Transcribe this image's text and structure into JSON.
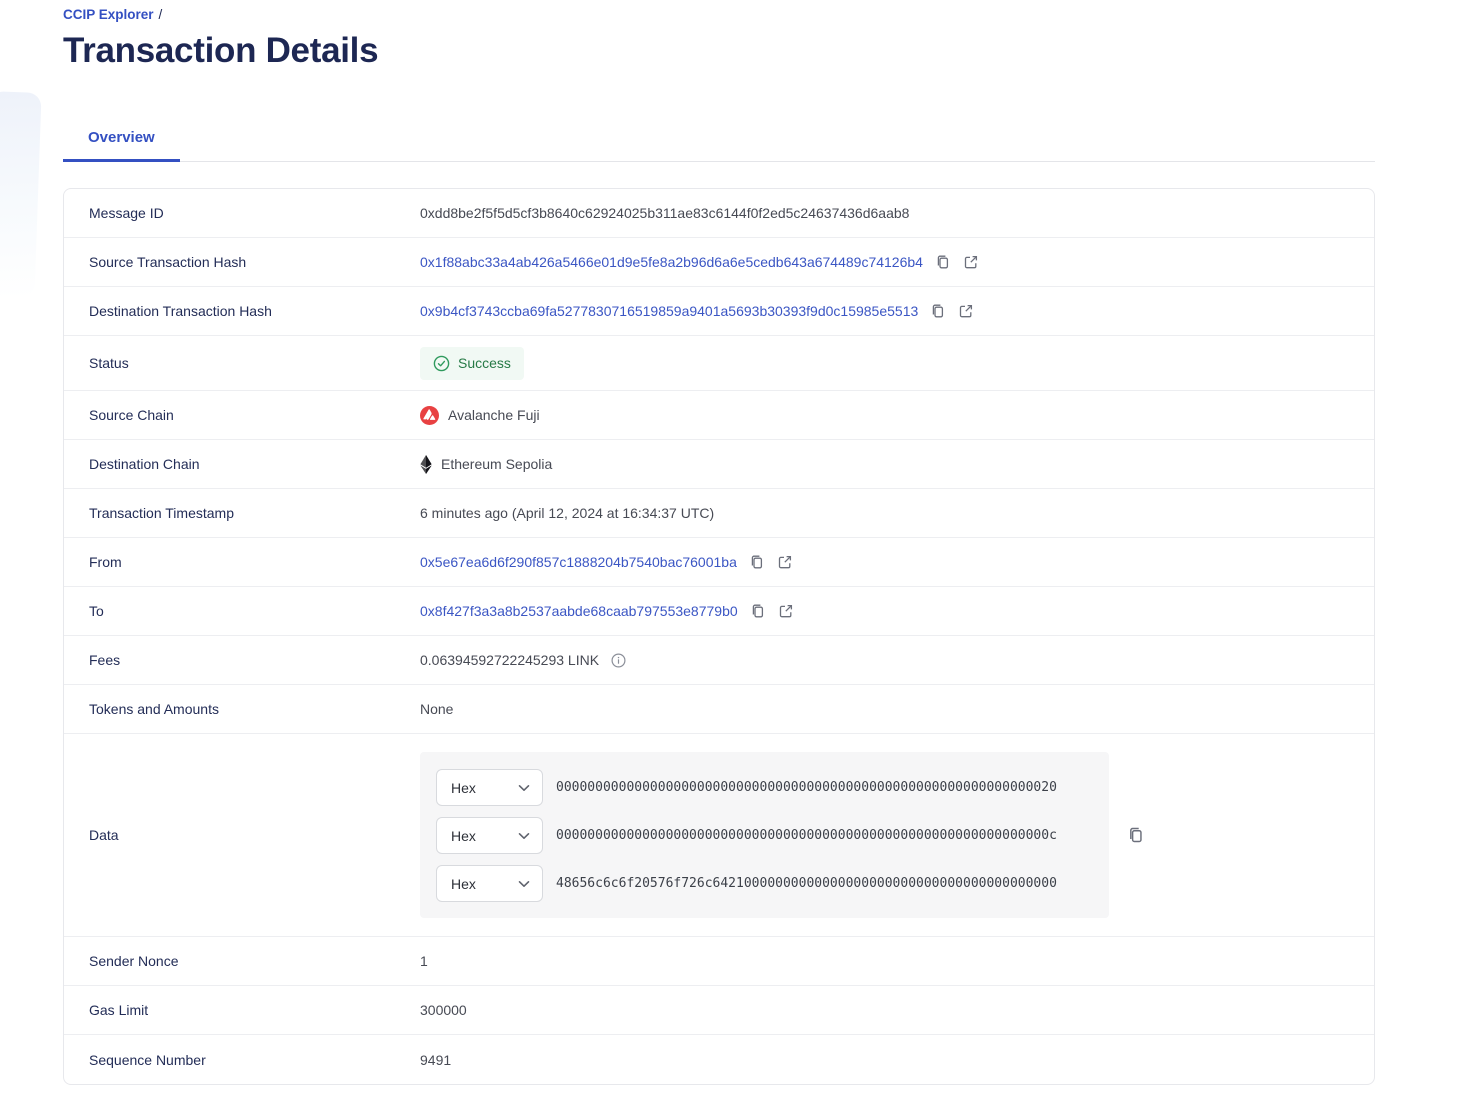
{
  "page": {
    "breadcrumb": "CCIP Explorer",
    "breadcrumb_separator": "/",
    "title": "Transaction Details"
  },
  "tabs": {
    "overview": "Overview"
  },
  "colors": {
    "accent_blue": "#3450c2",
    "title_navy": "#1d2753",
    "link_blue": "#3b56c4",
    "success_green": "#267a46",
    "success_bg": "#f1f9f4",
    "avalanche_red": "#e84142",
    "data_panel_bg": "#f6f6f7"
  },
  "rows": {
    "message_id": {
      "label": "Message ID",
      "value": "0xdd8be2f5f5d5cf3b8640c62924025b311ae83c6144f0f2ed5c24637436d6aab8"
    },
    "source_tx": {
      "label": "Source Transaction Hash",
      "value": "0x1f88abc33a4ab426a5466e01d9e5fe8a2b96d6a6e5cedb643a674489c74126b4"
    },
    "dest_tx": {
      "label": "Destination Transaction Hash",
      "value": "0x9b4cf3743ccba69fa5277830716519859a9401a5693b30393f9d0c15985e5513"
    },
    "status": {
      "label": "Status",
      "value": "Success"
    },
    "source_chain": {
      "label": "Source Chain",
      "value": "Avalanche Fuji",
      "icon": "avalanche-logo"
    },
    "dest_chain": {
      "label": "Destination Chain",
      "value": "Ethereum Sepolia",
      "icon": "ethereum-logo"
    },
    "timestamp": {
      "label": "Transaction Timestamp",
      "value": "6 minutes ago (April 12, 2024 at 16:34:37 UTC)"
    },
    "from": {
      "label": "From",
      "value": "0x5e67ea6d6f290f857c1888204b7540bac76001ba"
    },
    "to": {
      "label": "To",
      "value": "0x8f427f3a3a8b2537aabde68caab797553e8779b0"
    },
    "fees": {
      "label": "Fees",
      "value": "0.06394592722245293 LINK"
    },
    "tokens": {
      "label": "Tokens and Amounts",
      "value": "None"
    },
    "data": {
      "label": "Data",
      "format_label": "Hex",
      "lines": [
        "0000000000000000000000000000000000000000000000000000000000000020",
        "000000000000000000000000000000000000000000000000000000000000000c",
        "48656c6c6f20576f726c64210000000000000000000000000000000000000000"
      ]
    },
    "sender_nonce": {
      "label": "Sender Nonce",
      "value": "1"
    },
    "gas_limit": {
      "label": "Gas Limit",
      "value": "300000"
    },
    "sequence_number": {
      "label": "Sequence Number",
      "value": "9491"
    }
  }
}
